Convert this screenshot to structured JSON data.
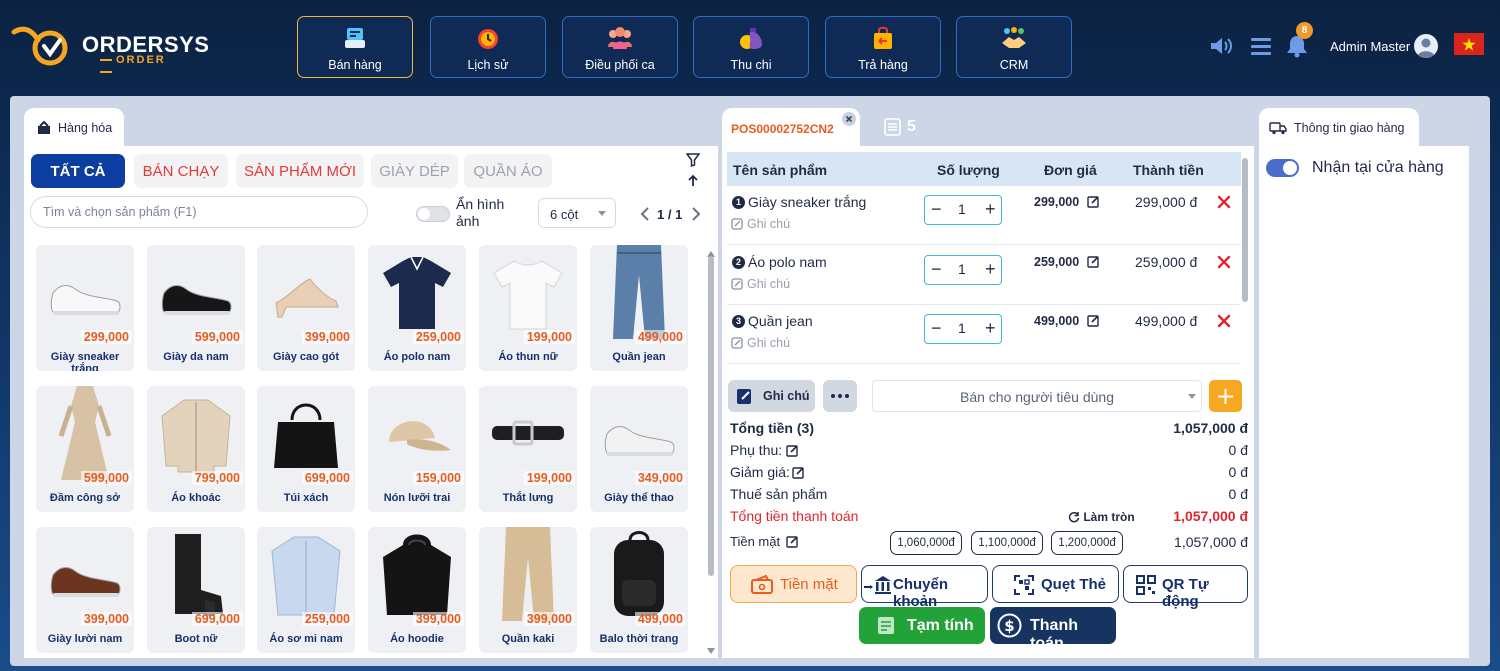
{
  "brand": {
    "name": "ORDERSYS",
    "sub": "ORDER"
  },
  "nav": [
    {
      "label": "Bán hàng",
      "icon": "pos-icon"
    },
    {
      "label": "Lịch sử",
      "icon": "history-clock-icon"
    },
    {
      "label": "Điều phối ca",
      "icon": "team-icon"
    },
    {
      "label": "Thu chi",
      "icon": "money-bag-icon"
    },
    {
      "label": "Trả hàng",
      "icon": "return-bag-icon"
    },
    {
      "label": "CRM",
      "icon": "handshake-icon"
    }
  ],
  "header": {
    "notifications": "8",
    "user": "Admin Master"
  },
  "products_panel": {
    "tab_label": "Hàng hóa",
    "filters": [
      "TẤT CẢ",
      "BÁN CHẠY",
      "SẢN PHẨM MỚI",
      "GIÀY DÉP",
      "QUẦN ÁO"
    ],
    "search_placeholder": "Tìm và chọn sản phẩm (F1)",
    "hide_images_label": "Ẩn hình ảnh",
    "columns_select": "6 cột",
    "pager": "1 / 1",
    "products": [
      {
        "name": "Giày sneaker trắng",
        "price": "299,000"
      },
      {
        "name": "Giày da nam",
        "price": "599,000"
      },
      {
        "name": "Giày cao gót",
        "price": "399,000"
      },
      {
        "name": "Áo polo nam",
        "price": "259,000"
      },
      {
        "name": "Áo thun nữ",
        "price": "199,000"
      },
      {
        "name": "Quần jean",
        "price": "499,000"
      },
      {
        "name": "Đầm công sở",
        "price": "599,000"
      },
      {
        "name": "Áo khoác",
        "price": "799,000"
      },
      {
        "name": "Túi xách",
        "price": "699,000"
      },
      {
        "name": "Nón lưỡi trai",
        "price": "159,000"
      },
      {
        "name": "Thắt lưng",
        "price": "199,000"
      },
      {
        "name": "Giày thể thao",
        "price": "349,000"
      },
      {
        "name": "Giày lười nam",
        "price": "399,000"
      },
      {
        "name": "Boot nữ",
        "price": "699,000"
      },
      {
        "name": "Áo sơ mi nam",
        "price": "259,000"
      },
      {
        "name": "Áo hoodie",
        "price": "399,000"
      },
      {
        "name": "Quần kaki",
        "price": "399,000"
      },
      {
        "name": "Balo thời trang",
        "price": "499,000"
      }
    ]
  },
  "order": {
    "tab_label": "POS00002752CN2",
    "order_count": "5",
    "columns": {
      "name": "Tên sản phẩm",
      "qty": "Số lượng",
      "unit": "Đơn giá",
      "total": "Thành tiền"
    },
    "note_placeholder": "Ghi chú",
    "items": [
      {
        "index": "1",
        "name": "Giày sneaker trắng",
        "qty": "1",
        "unit_price": "299,000",
        "total": "299,000 đ"
      },
      {
        "index": "2",
        "name": "Áo polo nam",
        "qty": "1",
        "unit_price": "259,000",
        "total": "259,000 đ"
      },
      {
        "index": "3",
        "name": "Quần jean",
        "qty": "1",
        "unit_price": "499,000",
        "total": "499,000 đ"
      }
    ],
    "note_button": "Ghi chú",
    "customer_select": "Bán cho người tiêu dùng",
    "summary": {
      "total_label": "Tổng tiền (3)",
      "total": "1,057,000 đ",
      "surcharge_label": "Phụ thu:",
      "surcharge": "0 đ",
      "discount_label": "Giảm giá:",
      "discount": "0 đ",
      "tax_label": "Thuế sản phẩm",
      "tax": "0 đ",
      "pay_label": "Tổng tiền thanh toán",
      "round_label": "Làm tròn",
      "pay_total": "1,057,000 đ",
      "cash_label": "Tiền mặt",
      "cash_value": "1,057,000 đ"
    },
    "quick_amounts": [
      "1,060,000đ",
      "1,100,000đ",
      "1,200,000đ"
    ],
    "pay_methods": [
      "Tiền mặt",
      "Chuyển khoản",
      "Quẹt Thẻ",
      "QR Tự động"
    ],
    "actions": {
      "draft": "Tạm tính",
      "checkout": "Thanh toán"
    }
  },
  "delivery": {
    "tab_label": "Thông tin giao hàng",
    "pickup_label": "Nhận tại cửa hàng"
  }
}
